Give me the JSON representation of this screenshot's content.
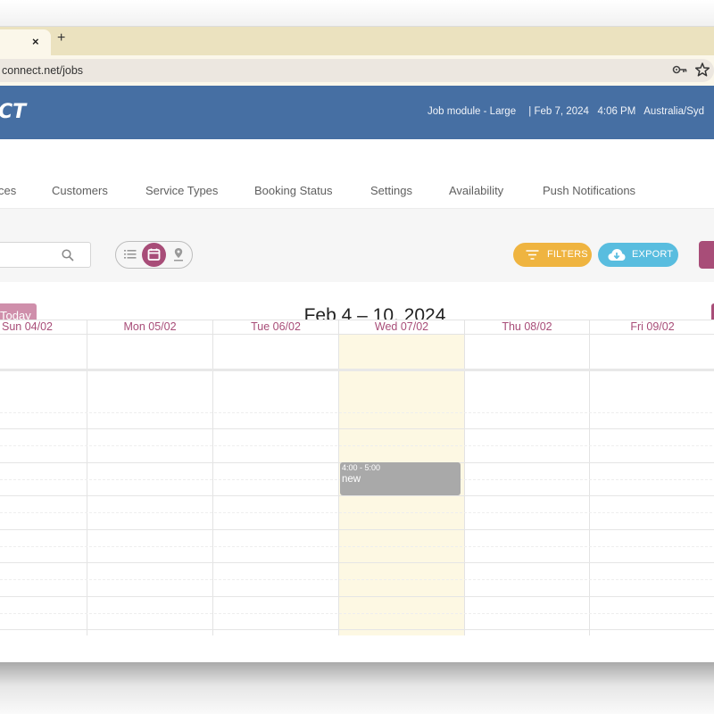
{
  "browser": {
    "tab_close": "×",
    "new_tab": "+",
    "url": "connect.net/jobs"
  },
  "header": {
    "logo": "CT",
    "module": "Job module - Large",
    "separator": "|",
    "date": "Feb 7, 2024",
    "time": "4:06 PM",
    "timezone": "Australia/Syd"
  },
  "nav": {
    "items": [
      {
        "label": "ces"
      },
      {
        "label": "Customers"
      },
      {
        "label": "Service Types"
      },
      {
        "label": "Booking Status"
      },
      {
        "label": "Settings"
      },
      {
        "label": "Availability"
      },
      {
        "label": "Push Notifications"
      }
    ]
  },
  "filterbar": {
    "search_placeholder": "",
    "view_modes": [
      "list",
      "calendar",
      "map"
    ],
    "active_view": "calendar",
    "filters_label": "FILTERS",
    "export_label": "EXPORT"
  },
  "calendar": {
    "today_label": "Today",
    "title": "Feb 4 – 10, 2024",
    "days": [
      {
        "label": "Sun 04/02",
        "today": false
      },
      {
        "label": "Mon 05/02",
        "today": false
      },
      {
        "label": "Tue 06/02",
        "today": true
      },
      {
        "label": "Wed 07/02",
        "today": true
      },
      {
        "label": "Thu 08/02",
        "today": false
      },
      {
        "label": "Fri 09/02",
        "today": false
      }
    ],
    "events": [
      {
        "time": "4:00 - 5:00",
        "title": "new",
        "day": "Wed 07/02"
      }
    ]
  },
  "colors": {
    "brand_blue": "#466fa3",
    "accent": "#a84d78",
    "filters": "#efb440",
    "export": "#59bddf",
    "today_column": "#fdf8e3",
    "event": "#a9a9a9"
  }
}
